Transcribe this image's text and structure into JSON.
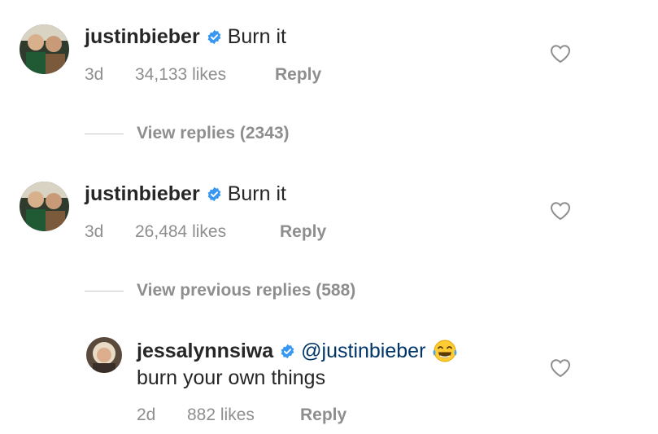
{
  "comments": [
    {
      "username": "justinbieber",
      "text": "Burn it",
      "age": "3d",
      "likes": "34,133 likes",
      "reply_label": "Reply",
      "view_replies": "View replies (2343)"
    },
    {
      "username": "justinbieber",
      "text": "Burn it",
      "age": "3d",
      "likes": "26,484 likes",
      "reply_label": "Reply",
      "view_replies": "View previous replies (588)"
    }
  ],
  "reply": {
    "username": "jessalynnsiwa",
    "mention": "@justinbieber",
    "emoji": "face-with-tears-of-joy",
    "text": "burn your own things",
    "age": "2d",
    "likes": "882 likes",
    "reply_label": "Reply"
  },
  "icons": {
    "verified": "verified-badge-icon",
    "like": "heart-outline-icon"
  },
  "colors": {
    "verified": "#3897f0",
    "meta_text": "#8e8e8e",
    "primary_text": "#262626"
  }
}
